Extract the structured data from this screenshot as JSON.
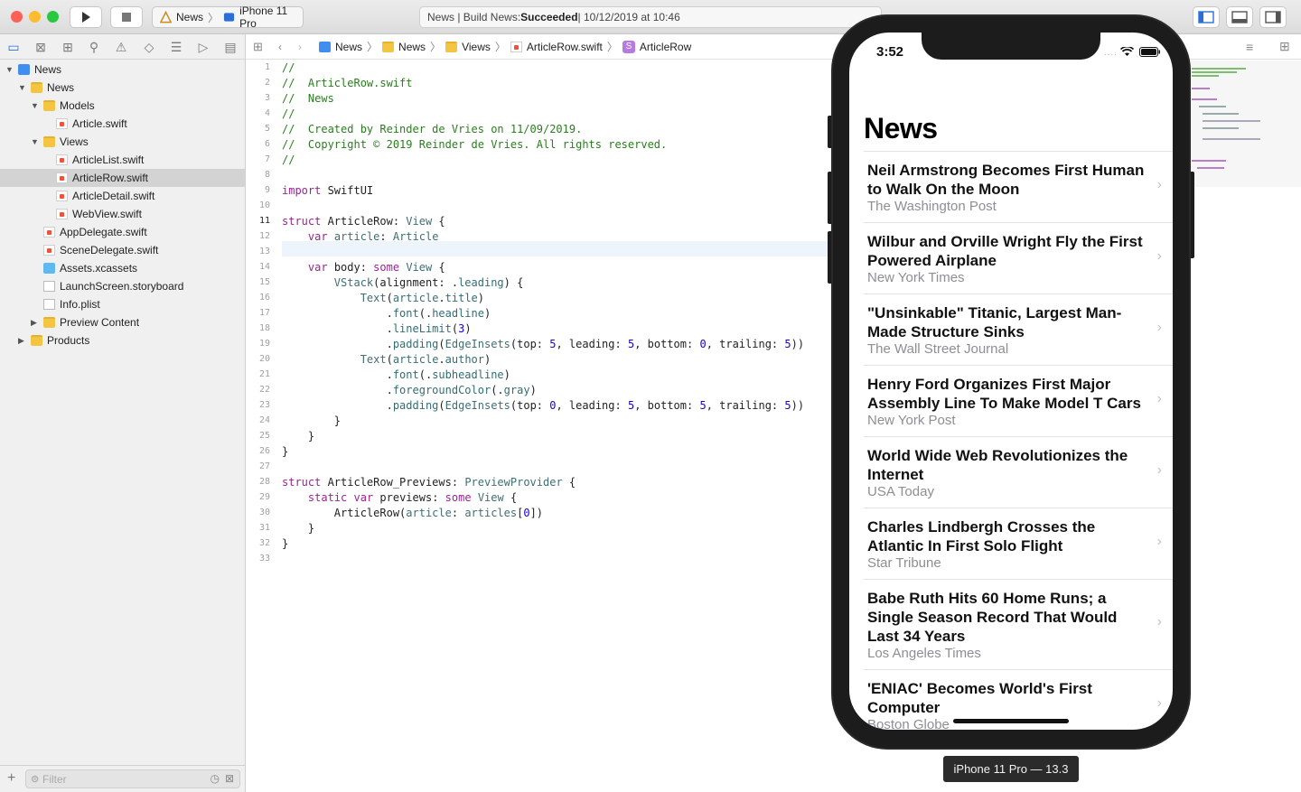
{
  "toolbar": {
    "scheme_project": "News",
    "scheme_device": "iPhone 11 Pro",
    "status_prefix": "News | Build News: ",
    "status_result": "Succeeded",
    "status_suffix": " | 10/12/2019 at 10:46"
  },
  "navigator": {
    "items": [
      {
        "label": "News"
      },
      {
        "label": "News"
      },
      {
        "label": "Models"
      },
      {
        "label": "Article.swift"
      },
      {
        "label": "Views"
      },
      {
        "label": "ArticleList.swift"
      },
      {
        "label": "ArticleRow.swift"
      },
      {
        "label": "ArticleDetail.swift"
      },
      {
        "label": "WebView.swift"
      },
      {
        "label": "AppDelegate.swift"
      },
      {
        "label": "SceneDelegate.swift"
      },
      {
        "label": "Assets.xcassets"
      },
      {
        "label": "LaunchScreen.storyboard"
      },
      {
        "label": "Info.plist"
      },
      {
        "label": "Preview Content"
      },
      {
        "label": "Products"
      }
    ],
    "filter_placeholder": "Filter"
  },
  "jumpbar": {
    "crumbs": [
      "News",
      "News",
      "Views",
      "ArticleRow.swift",
      "ArticleRow"
    ]
  },
  "editor": {
    "line_numbers": [
      "1",
      "2",
      "3",
      "4",
      "5",
      "6",
      "7",
      "8",
      "9",
      "10",
      "11",
      "12",
      "13",
      "14",
      "15",
      "16",
      "17",
      "18",
      "19",
      "20",
      "21",
      "22",
      "23",
      "24",
      "25",
      "26",
      "27",
      "28",
      "29",
      "30",
      "31",
      "32",
      "33"
    ],
    "lines": [
      "//",
      "//  ArticleRow.swift",
      "//  News",
      "//",
      "//  Created by Reinder de Vries on 11/09/2019.",
      "//  Copyright © 2019 Reinder de Vries. All rights reserved.",
      "//",
      "",
      "import SwiftUI",
      "",
      "struct ArticleRow: View {",
      "    var article: Article",
      "",
      "    var body: some View {",
      "        VStack(alignment: .leading) {",
      "            Text(article.title)",
      "                .font(.headline)",
      "                .lineLimit(3)",
      "                .padding(EdgeInsets(top: 5, leading: 5, bottom: 0, trailing: 5))",
      "            Text(article.author)",
      "                .font(.subheadline)",
      "                .foregroundColor(.gray)",
      "                .padding(EdgeInsets(top: 0, leading: 5, bottom: 5, trailing: 5))",
      "        }",
      "    }",
      "}",
      "",
      "struct ArticleRow_Previews: PreviewProvider {",
      "    static var previews: some View {",
      "        ArticleRow(article: articles[0])",
      "    }",
      "}",
      ""
    ]
  },
  "preview": {
    "time": "3:52",
    "nav_title": "News",
    "articles": [
      {
        "title": "Neil Armstrong Becomes First Human to Walk On the Moon",
        "author": "The Washington Post"
      },
      {
        "title": "Wilbur and Orville Wright Fly the First Powered Airplane",
        "author": "New York Times"
      },
      {
        "title": "\"Unsinkable\" Titanic, Largest Man-Made Structure Sinks",
        "author": "The Wall Street Journal"
      },
      {
        "title": "Henry Ford Organizes First Major Assembly Line To Make Model T Cars",
        "author": "New York Post"
      },
      {
        "title": "World Wide Web Revolutionizes the Internet",
        "author": "USA Today"
      },
      {
        "title": "Charles Lindbergh Crosses the Atlantic In First Solo Flight",
        "author": "Star Tribune"
      },
      {
        "title": "Babe Ruth Hits 60 Home Runs; a Single Season Record That Would Last 34 Years",
        "author": "Los Angeles Times"
      },
      {
        "title": "'ENIAC' Becomes World's First Computer",
        "author": "Boston Globe"
      }
    ],
    "device_label": "iPhone 11 Pro — 13.3"
  },
  "colors": {
    "comment": "#2a7d1f",
    "keyword": "#9b2393",
    "type": "#3f6e74",
    "number": "#1c00cf"
  }
}
